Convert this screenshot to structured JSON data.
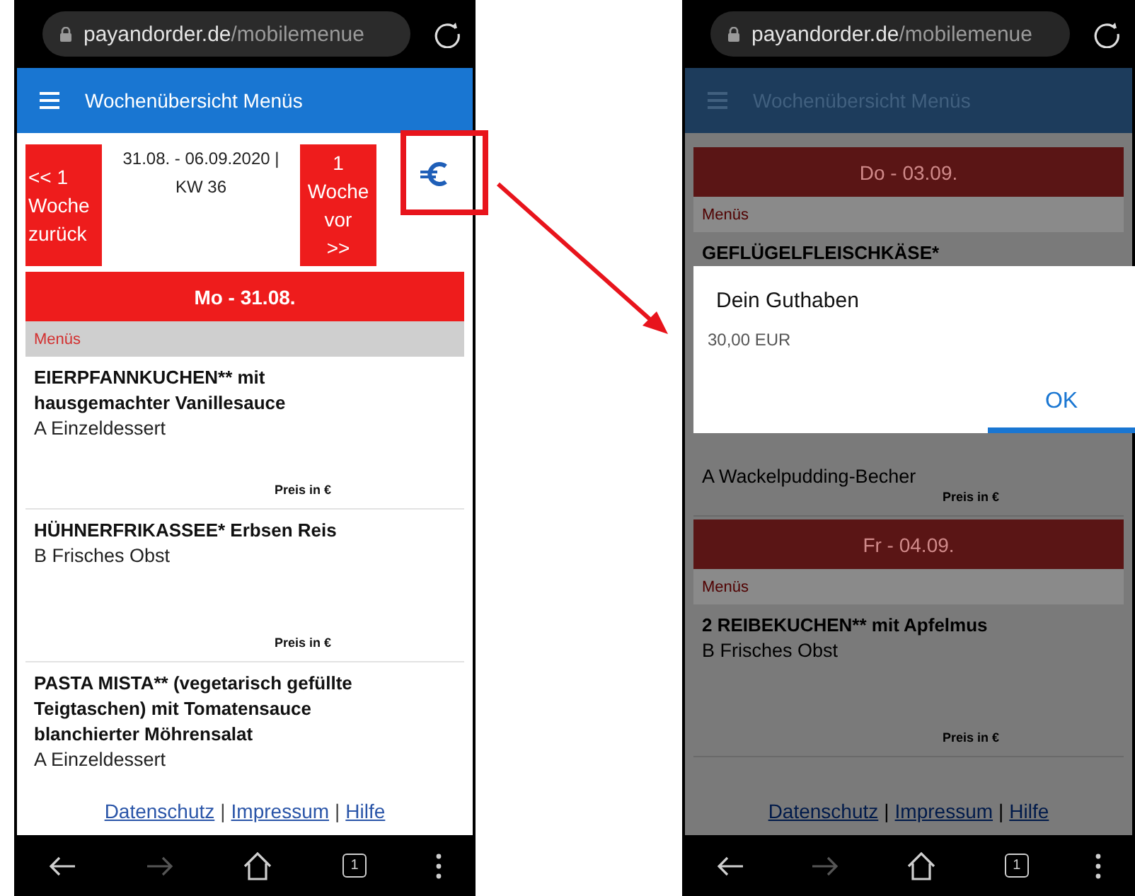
{
  "phones": [
    {
      "address_bar": {
        "domain": "payandorder.de",
        "path": "/mobilemenue"
      },
      "app_bar": {
        "title": "Wochenübersicht Menüs"
      },
      "week_nav": {
        "prev_lines": [
          "<< 1",
          "Woche",
          "zurück"
        ],
        "range": "31.08. - 06.09.2020 | KW 36",
        "next_lines": [
          "1",
          "Woche",
          "vor",
          ">>"
        ],
        "balance_highlighted": true
      },
      "days": [
        {
          "label": "Mo - 31.08.",
          "section": "Menüs",
          "items": [
            {
              "title": "EIERPFANNKUCHEN** mit hausgemachter Vanillesauce",
              "side": "A Einzeldessert",
              "price_label": "Preis in €"
            },
            {
              "title": "HÜHNERFRIKASSEE* Erbsen Reis",
              "side": "B Frisches Obst",
              "price_label": "Preis in €"
            },
            {
              "title": "PASTA MISTA** (vegetarisch gefüllte Teigtaschen) mit Tomatensauce blanchierter Möhrensalat",
              "side": "A Einzeldessert"
            }
          ]
        }
      ],
      "footer": {
        "links": [
          "Datenschutz",
          "Impressum",
          "Hilfe"
        ],
        "separator": "|"
      },
      "nav_buttons": [
        {
          "kind": "back",
          "disabled": false
        },
        {
          "kind": "forward",
          "disabled": true
        },
        {
          "kind": "home",
          "disabled": false
        },
        {
          "kind": "tabs",
          "label": "1",
          "disabled": false
        },
        {
          "kind": "menu",
          "disabled": false
        }
      ]
    },
    {
      "address_bar": {
        "domain": "payandorder.de",
        "path": "/mobilemenue"
      },
      "app_bar": {
        "title": "Wochenübersicht Menüs"
      },
      "days": [
        {
          "label": "Do - 03.09.",
          "section": "Menüs",
          "items": [
            {
              "title": "GEFLÜGELFLEISCHKÄSE*",
              "side": "A Wackelpudding-Becher",
              "price_label": "Preis in €"
            }
          ]
        },
        {
          "label": "Fr - 04.09.",
          "section": "Menüs",
          "items": [
            {
              "title": "2 REIBEKUCHEN** mit Apfelmus",
              "side": "B Frisches Obst",
              "price_label": "Preis in €"
            }
          ]
        }
      ],
      "dialog": {
        "title": "Dein Guthaben",
        "message": "30,00 EUR",
        "button": "OK"
      },
      "footer": {
        "links": [
          "Datenschutz",
          "Impressum",
          "Hilfe"
        ],
        "separator": "|"
      },
      "nav_buttons": [
        {
          "kind": "back",
          "disabled": false
        },
        {
          "kind": "forward",
          "disabled": true
        },
        {
          "kind": "home",
          "disabled": false
        },
        {
          "kind": "tabs",
          "label": "1",
          "disabled": false
        },
        {
          "kind": "menu",
          "disabled": false
        }
      ]
    }
  ]
}
